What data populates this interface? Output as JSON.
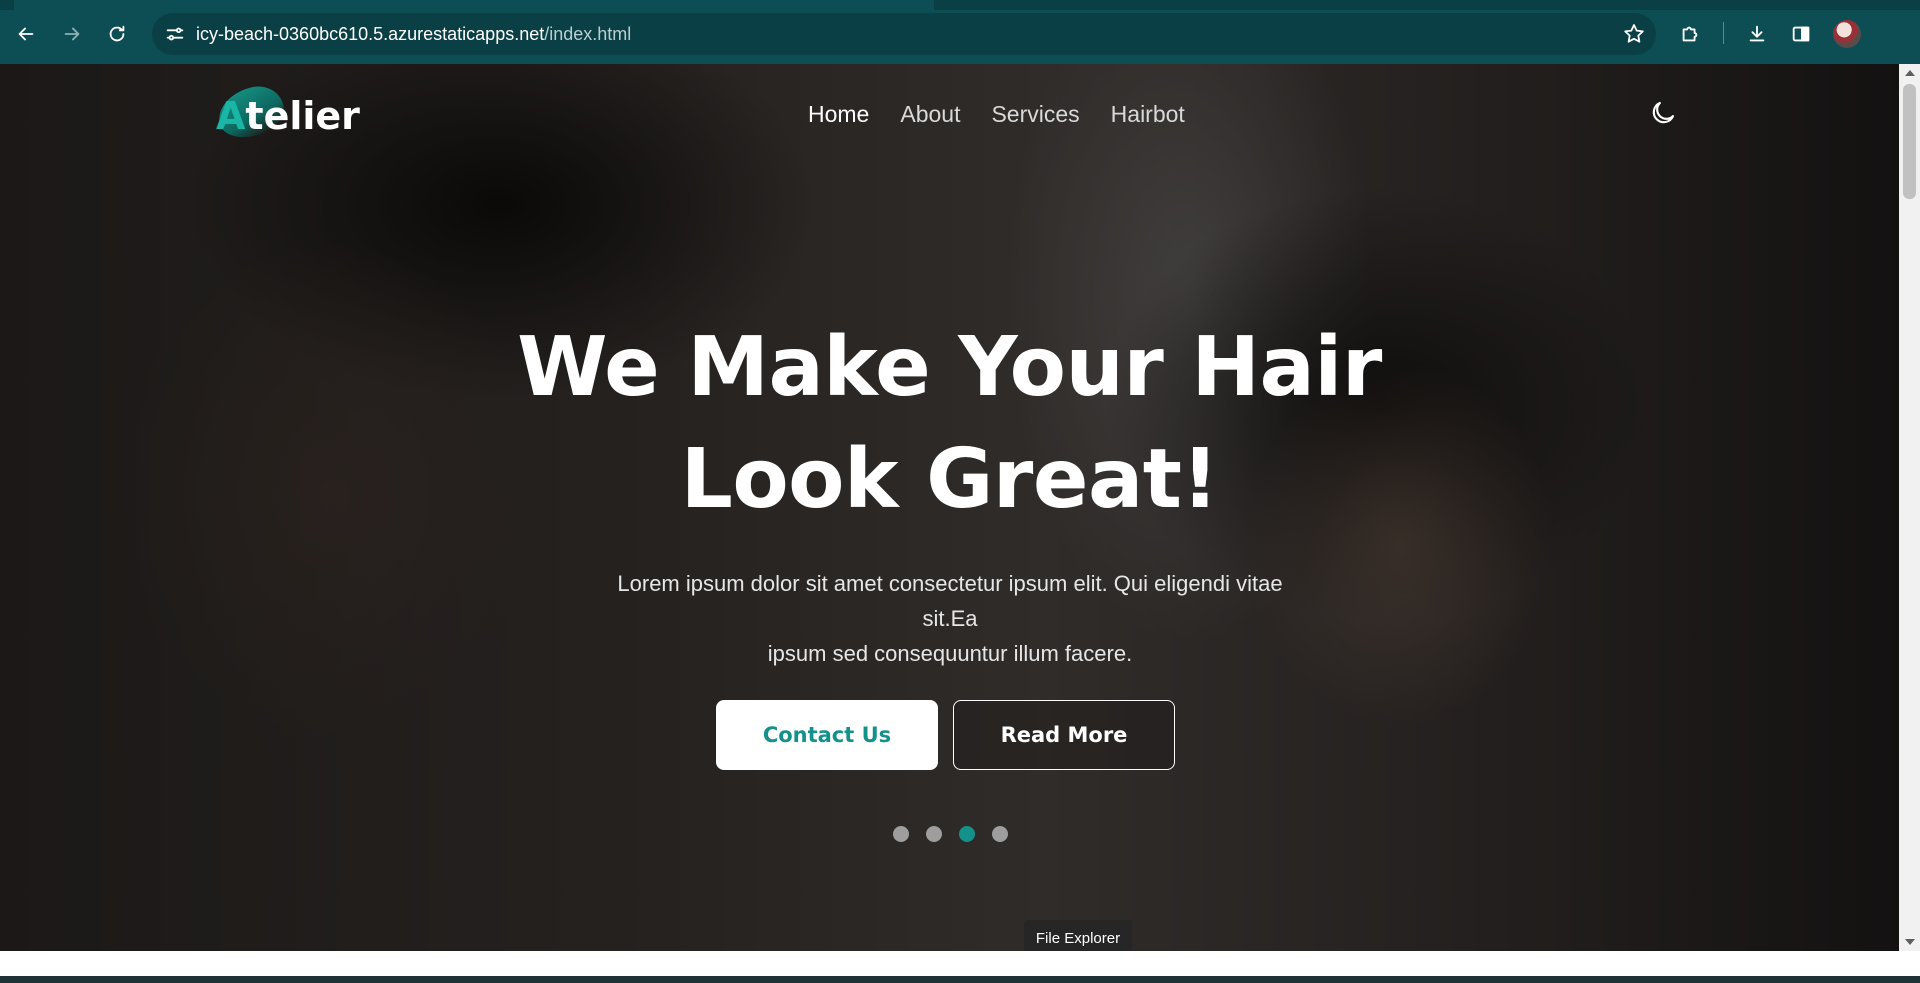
{
  "browser": {
    "url_domain": "icy-beach-0360bc610.5.azurestaticapps.net",
    "url_path": "/index.html",
    "icons": {
      "back": "back-arrow-icon",
      "forward": "forward-arrow-icon",
      "reload": "reload-icon",
      "site_info": "site-info-icon",
      "bookmark": "star-icon",
      "extensions": "puzzle-icon",
      "downloads": "download-icon",
      "side_panel": "side-panel-icon",
      "profile": "avatar"
    }
  },
  "site": {
    "logo_first": "A",
    "logo_rest": "telier",
    "nav": [
      {
        "label": "Home",
        "active": true
      },
      {
        "label": "About",
        "active": false
      },
      {
        "label": "Services",
        "active": false
      },
      {
        "label": "Hairbot",
        "active": false
      }
    ],
    "theme_toggle_icon": "moon-icon"
  },
  "hero": {
    "headline_line1": "We Make Your Hair",
    "headline_line2": "Look Great!",
    "subtitle_line1": "Lorem ipsum dolor sit amet consectetur ipsum elit. Qui eligendi vitae sit.Ea",
    "subtitle_line2": "ipsum sed consequuntur illum facere.",
    "contact_label": "Contact Us",
    "read_more_label": "Read More",
    "slides_total": 4,
    "active_slide": 3
  },
  "os": {
    "tooltip": "File Explorer"
  },
  "colors": {
    "toolbar": "#0d4d54",
    "accent": "#13918a",
    "dot_inactive": "#9e9e9e"
  }
}
